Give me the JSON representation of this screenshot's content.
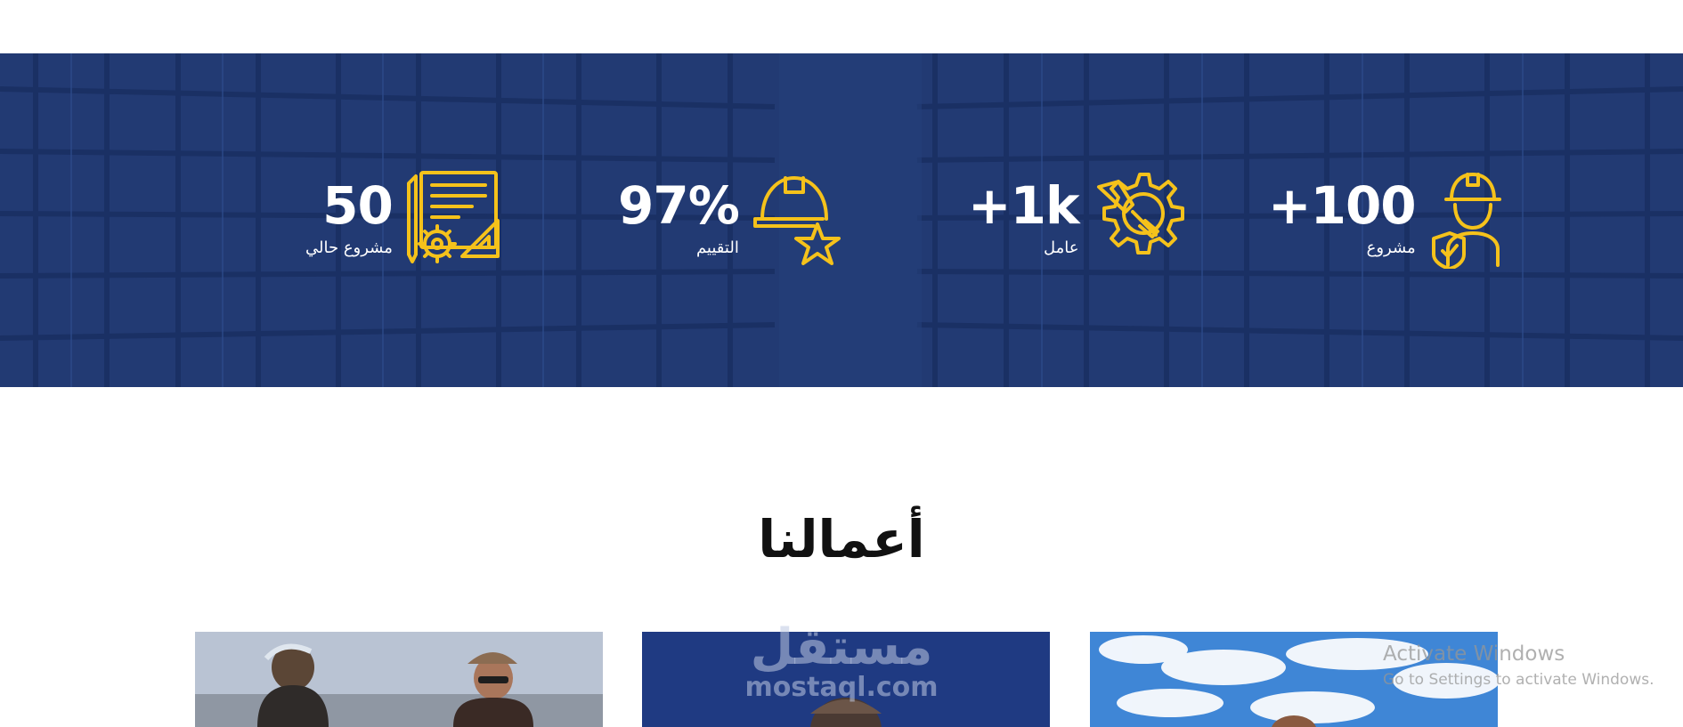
{
  "stats": [
    {
      "value": "+100",
      "label": "مشروع",
      "icon": "worker-shield-icon"
    },
    {
      "value": "+1k",
      "label": "عامل",
      "icon": "gear-wrench-icon"
    },
    {
      "value": "97%",
      "label": "التقييم",
      "icon": "helmet-star-icon"
    },
    {
      "value": "50",
      "label": "مشروع حالي",
      "icon": "blueprint-gear-icon"
    }
  ],
  "works": {
    "title": "أعمالنا",
    "cards": [
      {
        "image": "workers-on-site-photo"
      },
      {
        "image": "worker-blue-background-photo"
      },
      {
        "image": "sky-clouds-photo"
      }
    ]
  },
  "watermark": {
    "arabic": "مستقل",
    "latin": "mostaql.com"
  },
  "os_overlay": {
    "title": "Activate Windows",
    "subtitle": "Go to Settings to activate Windows."
  },
  "colors": {
    "band": "#223a73",
    "accent": "#f5c21b",
    "text_light": "#ffffff",
    "title": "#111111"
  }
}
